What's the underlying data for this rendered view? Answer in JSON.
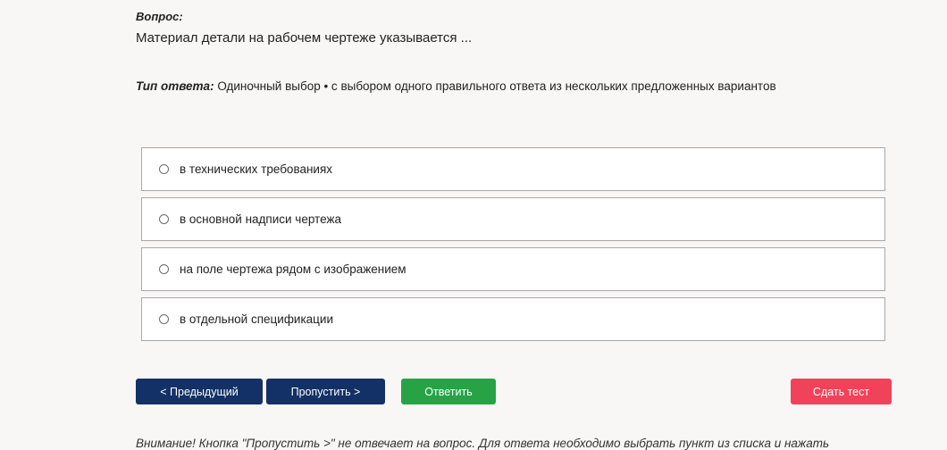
{
  "question": {
    "label": "Вопрос:",
    "text": "Материал детали на рабочем чертеже указывается ..."
  },
  "answer_type": {
    "label": "Тип ответа:",
    "value": " Одиночный выбор • с выбором одного правильного ответа из нескольких предложенных вариантов"
  },
  "options": [
    {
      "label": "в технических требованиях",
      "selected": false
    },
    {
      "label": "в основной надписи чертежа",
      "selected": false
    },
    {
      "label": "на поле чертежа рядом с изображением",
      "selected": false
    },
    {
      "label": "в отдельной спецификации",
      "selected": false
    }
  ],
  "buttons": {
    "prev": "< Предыдущий",
    "skip": "Пропустить >",
    "answer": "Ответить",
    "submit": "Сдать тест"
  },
  "notice": "Внимание! Кнопка \"Пропустить >\" не отвечает на вопрос. Для ответа необходимо выбрать пункт из списка и нажать",
  "colors": {
    "primary_button": "#133166",
    "answer_button": "#27a346",
    "submit_button": "#f0435a",
    "background": "#f8f7f6"
  }
}
